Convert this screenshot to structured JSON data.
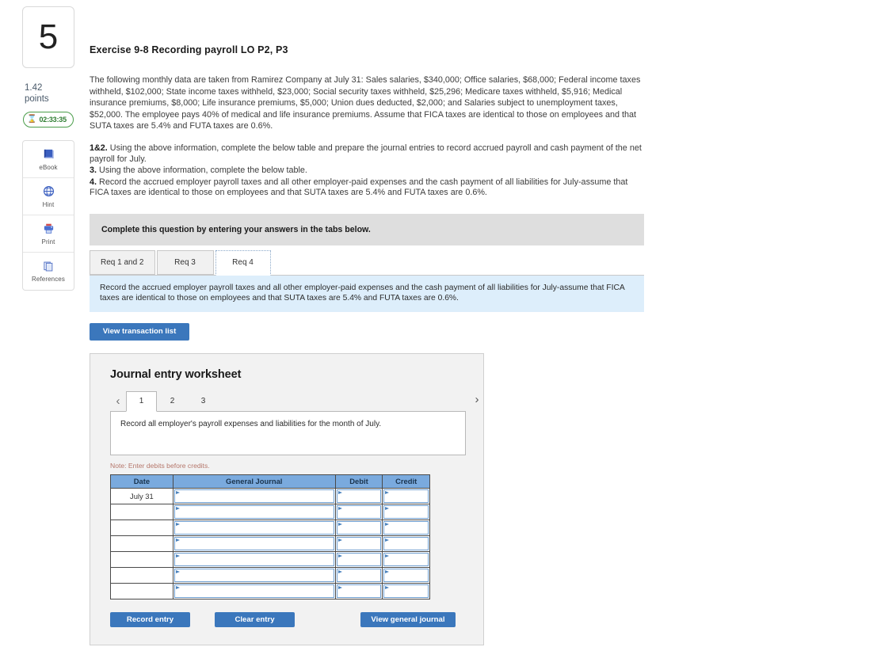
{
  "rail": {
    "question_number": "5",
    "points_value": "1.42",
    "points_label": "points",
    "timer_icon": "hourglass-icon",
    "timer_value": "02:33:35",
    "tools": [
      {
        "icon": "book-icon",
        "label": "eBook"
      },
      {
        "icon": "hint-globe-icon",
        "label": "Hint"
      },
      {
        "icon": "printer-icon",
        "label": "Print"
      },
      {
        "icon": "copy-pages-icon",
        "label": "References"
      }
    ]
  },
  "main": {
    "exercise_title": "Exercise 9-8 Recording payroll LO P2, P3",
    "intro_paragraph": "The following monthly data are taken from Ramirez Company at July 31: Sales salaries, $340,000; Office salaries, $68,000; Federal income taxes withheld, $102,000; State income taxes withheld, $23,000; Social security taxes withheld, $25,296; Medicare taxes withheld, $5,916; Medical insurance premiums, $8,000; Life insurance premiums, $5,000; Union dues deducted, $2,000; and Salaries subject to unemployment taxes, $52,000. The employee pays 40% of medical and life insurance premiums. Assume that FICA taxes are identical to those on employees and that SUTA taxes are 5.4% and FUTA taxes are 0.6%.",
    "requirements": [
      {
        "num": "1&2.",
        "text": " Using the above information, complete the below table and prepare the journal entries to record accrued payroll and cash payment of the net payroll for July."
      },
      {
        "num": "3.",
        "text": " Using the above information, complete the below table."
      },
      {
        "num": "4.",
        "text": " Record the accrued employer payroll taxes and all other employer-paid expenses and the cash payment of all liabilities for July-assume that FICA taxes are identical to those on employees and that SUTA taxes are 5.4% and FUTA taxes are 0.6%."
      }
    ],
    "gray_banner": "Complete this question by entering your answers in the tabs below.",
    "tabs": [
      {
        "label": "Req 1 and 2",
        "active": false
      },
      {
        "label": "Req 3",
        "active": false
      },
      {
        "label": "Req 4",
        "active": true
      }
    ],
    "blue_banner": "Record the accrued employer payroll taxes and all other employer-paid expenses and the cash payment of all liabilities for July-assume that FICA taxes are identical to those on employees and that SUTA taxes are 5.4% and FUTA taxes are 0.6%.",
    "view_transaction_list_label": "View transaction list"
  },
  "worksheet": {
    "title": "Journal entry worksheet",
    "prev_arrow": "‹",
    "next_arrow": "›",
    "page_tabs": [
      {
        "label": "1",
        "active": true
      },
      {
        "label": "2",
        "active": false
      },
      {
        "label": "3",
        "active": false
      }
    ],
    "description": "Record all employer's payroll expenses and liabilities for the month of July.",
    "note": "Note: Enter debits before credits.",
    "table": {
      "headers": [
        "Date",
        "General Journal",
        "Debit",
        "Credit"
      ],
      "rows": [
        {
          "date": "July 31",
          "general_journal": "",
          "debit": "",
          "credit": ""
        },
        {
          "date": "",
          "general_journal": "",
          "debit": "",
          "credit": ""
        },
        {
          "date": "",
          "general_journal": "",
          "debit": "",
          "credit": ""
        },
        {
          "date": "",
          "general_journal": "",
          "debit": "",
          "credit": ""
        },
        {
          "date": "",
          "general_journal": "",
          "debit": "",
          "credit": ""
        },
        {
          "date": "",
          "general_journal": "",
          "debit": "",
          "credit": ""
        },
        {
          "date": "",
          "general_journal": "",
          "debit": "",
          "credit": ""
        }
      ]
    },
    "buttons": {
      "record_entry": "Record entry",
      "clear_entry": "Clear entry",
      "view_general_journal": "View general journal"
    }
  },
  "colors": {
    "button_blue": "#3b77bc",
    "table_header_blue": "#7aaade",
    "blue_banner_bg": "#ddeefb",
    "gray_banner_bg": "#dedede",
    "panel_bg": "#f2f2f2",
    "timer_green": "#4a9d4a",
    "note_red": "#b5766a"
  }
}
